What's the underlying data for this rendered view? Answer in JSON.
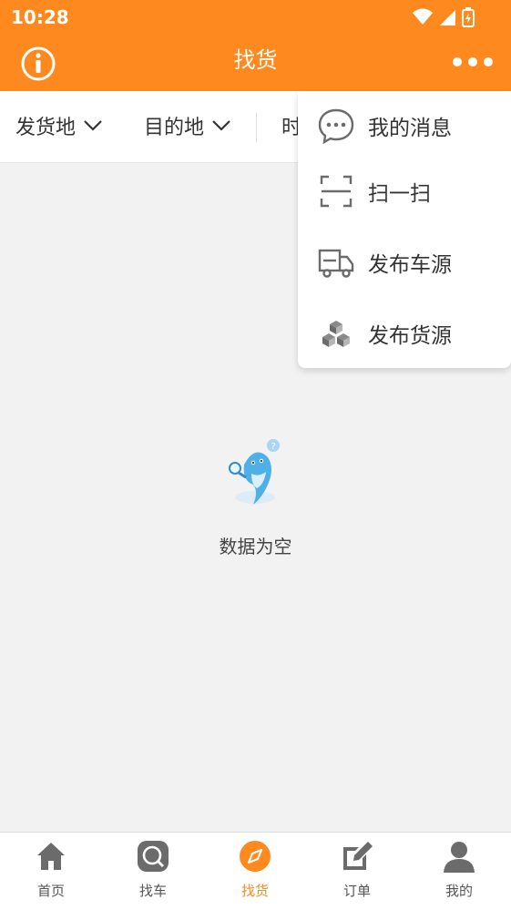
{
  "colors": {
    "brand": "#fe8a1f",
    "icon_gray": "#6b6b6b",
    "background": "#f2f2f2"
  },
  "status_bar": {
    "time": "10:28"
  },
  "header": {
    "title": "找货",
    "left_icon": "info-icon",
    "right_icon": "more-icon"
  },
  "filters": [
    {
      "label": "发货地",
      "icon": "chevron-down-icon"
    },
    {
      "label": "目的地",
      "icon": "chevron-down-icon"
    },
    {
      "label": "时"
    }
  ],
  "menu": {
    "items": [
      {
        "label": "我的消息",
        "icon": "message-icon"
      },
      {
        "label": "扫一扫",
        "icon": "scan-icon"
      },
      {
        "label": "发布车源",
        "icon": "truck-icon"
      },
      {
        "label": "发布货源",
        "icon": "boxes-icon"
      }
    ]
  },
  "empty_state": {
    "text": "数据为空",
    "icon": "dolphin-illustration"
  },
  "tabbar": {
    "active_index": 2,
    "items": [
      {
        "label": "首页",
        "icon": "home-icon"
      },
      {
        "label": "找车",
        "icon": "search-car-icon"
      },
      {
        "label": "找货",
        "icon": "compass-icon"
      },
      {
        "label": "订单",
        "icon": "edit-icon"
      },
      {
        "label": "我的",
        "icon": "user-icon"
      }
    ]
  }
}
